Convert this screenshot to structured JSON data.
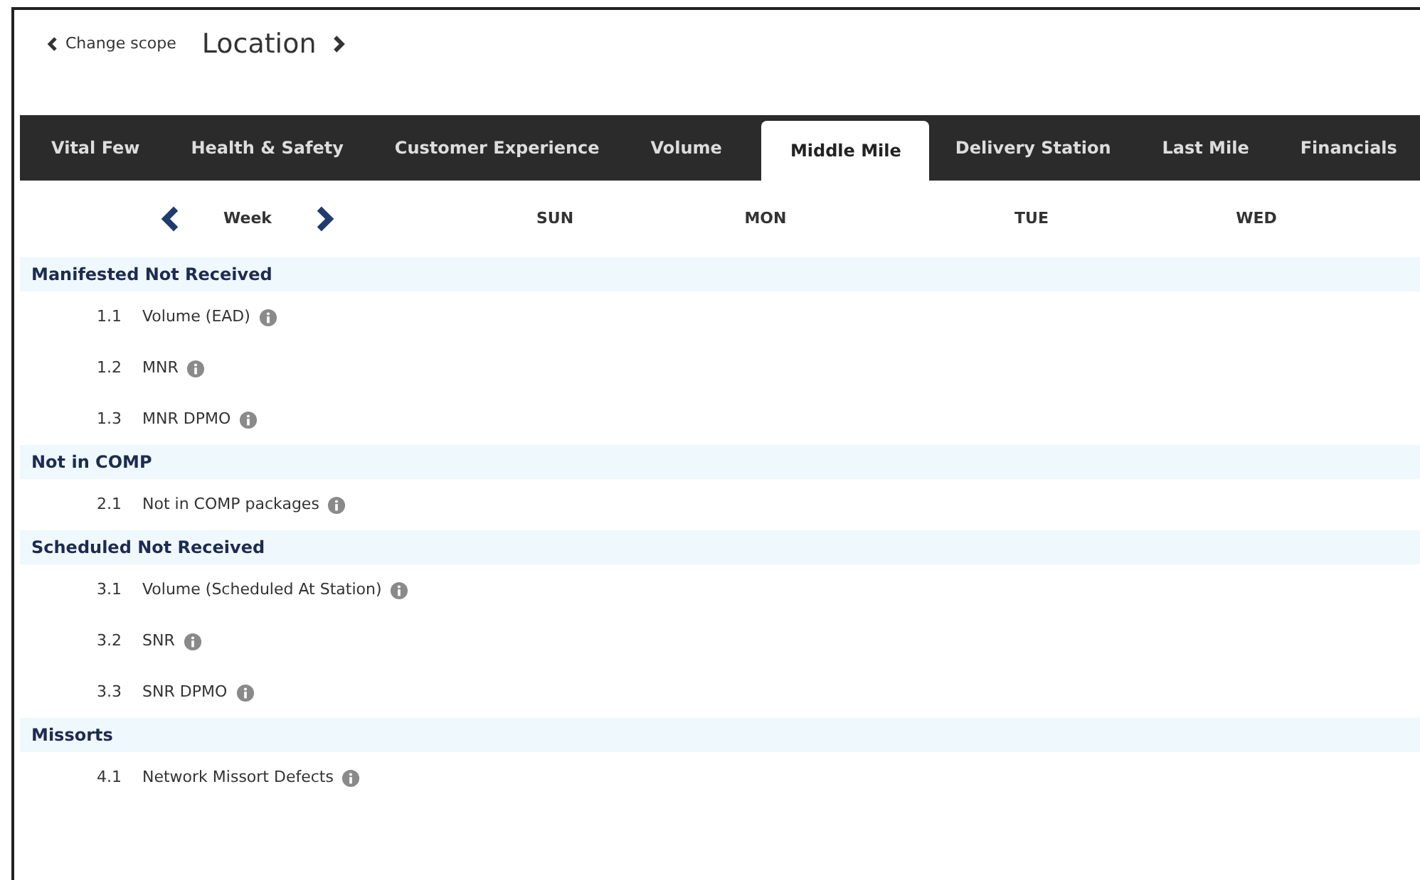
{
  "header": {
    "back_link": "Change scope",
    "scope_title": "Location"
  },
  "tabs": [
    {
      "label": "Vital Few",
      "selected": false
    },
    {
      "label": "Health & Safety",
      "selected": false
    },
    {
      "label": "Customer Experience",
      "selected": false
    },
    {
      "label": "Volume",
      "selected": false
    },
    {
      "label": "Middle Mile",
      "selected": true
    },
    {
      "label": "Delivery Station",
      "selected": false
    },
    {
      "label": "Last Mile",
      "selected": false
    },
    {
      "label": "Financials",
      "selected": false
    }
  ],
  "period": {
    "label": "Week"
  },
  "days": [
    "SUN",
    "MON",
    "TUE",
    "WED"
  ],
  "sections": [
    {
      "title": "Manifested Not Received",
      "metrics": [
        {
          "number": "1.1",
          "name": "Volume (EAD)"
        },
        {
          "number": "1.2",
          "name": "MNR"
        },
        {
          "number": "1.3",
          "name": "MNR DPMO"
        }
      ]
    },
    {
      "title": "Not in COMP",
      "metrics": [
        {
          "number": "2.1",
          "name": "Not in COMP packages"
        }
      ]
    },
    {
      "title": "Scheduled Not Received",
      "metrics": [
        {
          "number": "3.1",
          "name": "Volume (Scheduled At Station)"
        },
        {
          "number": "3.2",
          "name": "SNR"
        },
        {
          "number": "3.3",
          "name": "SNR DPMO"
        }
      ]
    },
    {
      "title": "Missorts",
      "metrics": [
        {
          "number": "4.1",
          "name": "Network Missort Defects"
        }
      ]
    }
  ]
}
